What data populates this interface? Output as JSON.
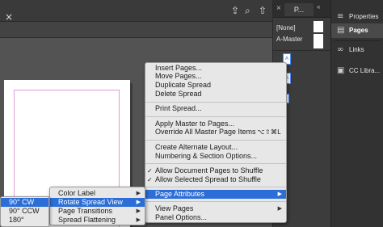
{
  "app": {
    "close_glyph": "×",
    "toolbar_icons": [
      {
        "name": "upload-icon",
        "glyph": "⇪"
      },
      {
        "name": "search-icon",
        "glyph": "⌕"
      },
      {
        "name": "share-icon",
        "glyph": "⇧"
      }
    ]
  },
  "pages_panel": {
    "close_glyph": "×",
    "tab_label": "P...",
    "collapse_glyph": "«",
    "none_label": "[None]",
    "master_label": "A-Master",
    "page_prefix": "A"
  },
  "side_panel": {
    "items": [
      {
        "label": "Properties",
        "icon": "properties-icon",
        "glyph": "≡"
      },
      {
        "label": "Pages",
        "icon": "pages-icon",
        "glyph": "▤"
      },
      {
        "label": "Links",
        "icon": "links-icon",
        "glyph": "∞"
      },
      {
        "label": "CC Libra...",
        "icon": "cc-libraries-icon",
        "glyph": "▣"
      }
    ]
  },
  "context_menu": {
    "items": [
      {
        "label": "Insert Pages..."
      },
      {
        "label": "Move Pages..."
      },
      {
        "label": "Duplicate Spread"
      },
      {
        "label": "Delete Spread"
      },
      {
        "label": "Print Spread..."
      },
      {
        "label": "Apply Master to Pages..."
      },
      {
        "label": "Override All Master Page Items",
        "shortcut": "⌥⇧⌘L"
      },
      {
        "label": "Create Alternate Layout..."
      },
      {
        "label": "Numbering & Section Options..."
      },
      {
        "label": "Allow Document Pages to Shuffle",
        "checked": "✓"
      },
      {
        "label": "Allow Selected Spread to Shuffle",
        "checked": "✓"
      },
      {
        "label": "Page Attributes",
        "submenu": "▶"
      },
      {
        "label": "View Pages",
        "submenu": "▶"
      },
      {
        "label": "Panel Options..."
      }
    ]
  },
  "page_attributes_menu": {
    "items": [
      {
        "label": "Color Label",
        "submenu": "▶"
      },
      {
        "label": "Rotate Spread View",
        "submenu": "▶"
      },
      {
        "label": "Page Transitions",
        "submenu": "▶"
      },
      {
        "label": "Spread Flattening",
        "submenu": "▶"
      }
    ]
  },
  "rotate_menu": {
    "items": [
      {
        "label": "90° CW"
      },
      {
        "label": "90° CCW"
      },
      {
        "label": "180°"
      }
    ]
  },
  "colors": {
    "highlight": "#2c6ed8",
    "margin_guide": "#e39bd9",
    "page_selection": "#4c8dfa"
  }
}
